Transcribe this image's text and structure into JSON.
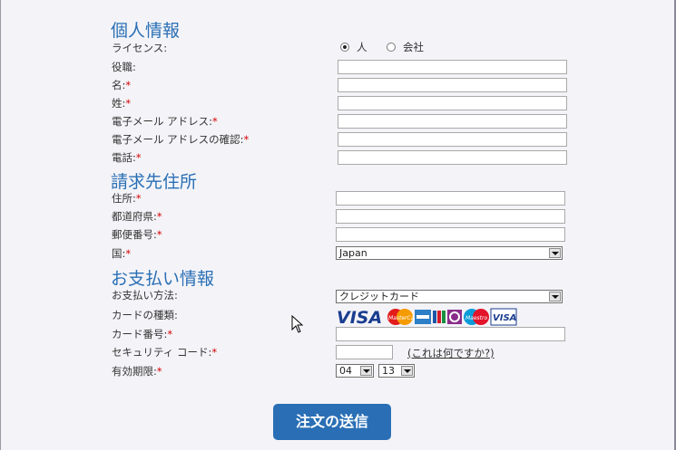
{
  "personal": {
    "title": "個人情報",
    "license_label": "ライセンス:",
    "license_options": [
      "人",
      "会社"
    ],
    "job_title_label": "役職:",
    "first_name_label": "名:",
    "last_name_label": "姓:",
    "email_label": "電子メール アドレス:",
    "email_confirm_label": "電子メール アドレスの確認:",
    "phone_label": "電話:",
    "required_mark": "*"
  },
  "billing": {
    "title": "請求先住所",
    "address_label": "住所:",
    "state_label": "都道府県:",
    "zip_label": "郵便番号:",
    "country_label": "国:",
    "country_value": "Japan"
  },
  "payment": {
    "title": "お支払い情報",
    "method_label": "お支払い方法:",
    "method_value": "クレジットカード",
    "card_type_label": "カードの種類:",
    "card_logos": [
      "visa-logo",
      "mastercard-logo",
      "amex-logo",
      "jcb-logo",
      "diners-logo",
      "maestro-logo",
      "visa-logo"
    ],
    "card_number_label": "カード番号:",
    "security_code_label": "セキュリティ コード:",
    "security_code_help": "(これは何ですか?)",
    "expiry_label": "有効期限:",
    "expiry_month": "04",
    "expiry_year": "13"
  },
  "submit_label": "注文の送信",
  "colors": {
    "accent": "#2a6fb5",
    "required": "#d40000"
  }
}
